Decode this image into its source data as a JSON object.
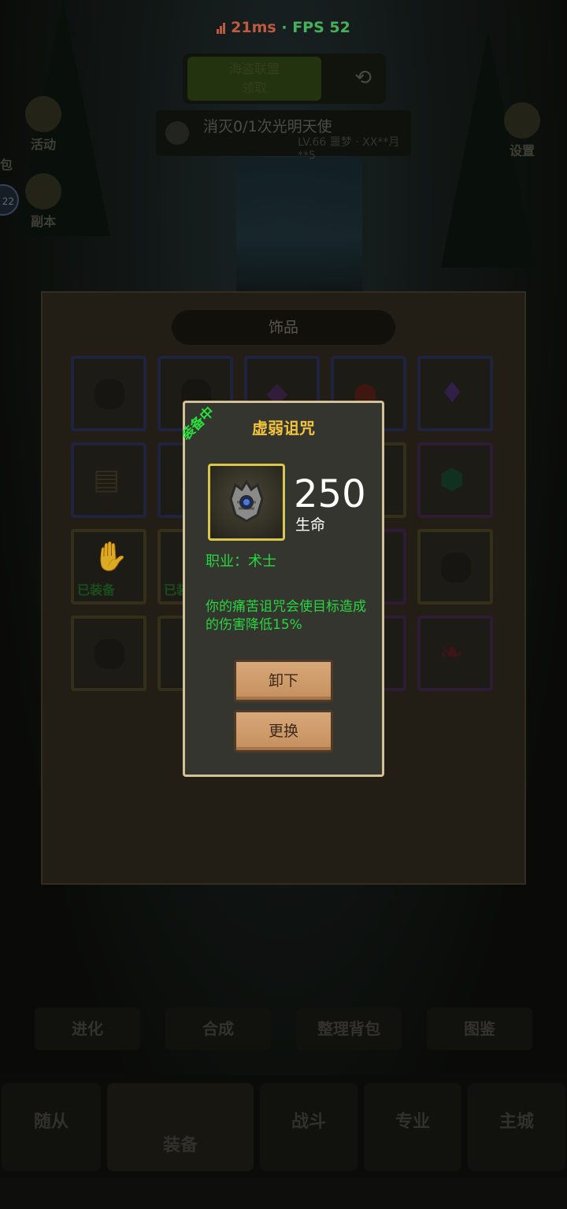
{
  "status": {
    "ping": "21ms",
    "separator": "·",
    "fps": "FPS 52"
  },
  "top_button": {
    "label_line1": "海盗联盟",
    "label_line2": "领取",
    "swap_icon": "swap-arrows-icon"
  },
  "quest": {
    "text": "消灭0/1次光明天使",
    "sub": "LV.66 噩梦 · XX**月**5"
  },
  "left_menu": [
    {
      "label": "活动",
      "icon": "star-icon"
    },
    {
      "label": "副本",
      "icon": "gate-icon"
    }
  ],
  "left_edge_label": "包",
  "avatar_level": "22",
  "settings": {
    "label": "设置",
    "icon": "gear-icon"
  },
  "panel": {
    "title": "饰品",
    "equipped_tag": "已装备",
    "equipped_tag_2": "已装"
  },
  "bottom_tabs": [
    "进化",
    "合成",
    "整理背包",
    "图鉴"
  ],
  "nav": [
    "随从",
    "装备",
    "战斗",
    "专业",
    "主城"
  ],
  "popup": {
    "ribbon": "装备中",
    "item_name": "虚弱诅咒",
    "stat_value": "250",
    "stat_label": "生命",
    "class_line": "职业：术士",
    "description": "你的痛苦诅咒会使目标造成的伤害降低15%",
    "unequip_label": "卸下",
    "replace_label": "更换",
    "item_icon": "cursed-hand-amulet-icon"
  },
  "colors": {
    "accent_gold": "#f0c33a",
    "green_text": "#27d63e",
    "popup_border": "#d2c096",
    "ping_color": "#e06a4a",
    "fps_color": "#53d06a"
  }
}
